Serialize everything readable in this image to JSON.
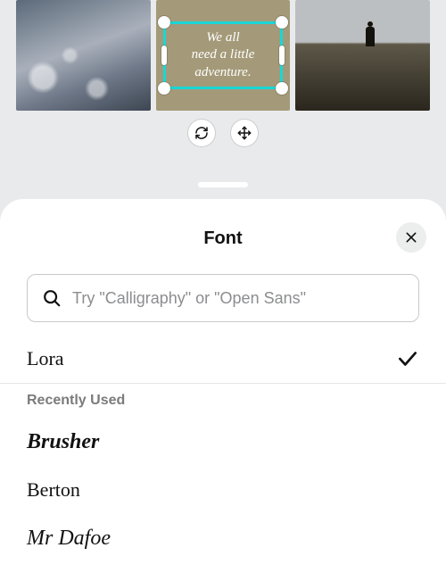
{
  "canvas": {
    "quote_text": "We all\nneed a little\nadventure."
  },
  "sheet": {
    "title": "Font",
    "search_placeholder": "Try \"Calligraphy\" or \"Open Sans\"",
    "selected_font": "Lora",
    "recent_label": "Recently Used",
    "fonts": {
      "recent": [
        "Brusher",
        "Berton",
        "Mr Dafoe"
      ]
    }
  }
}
